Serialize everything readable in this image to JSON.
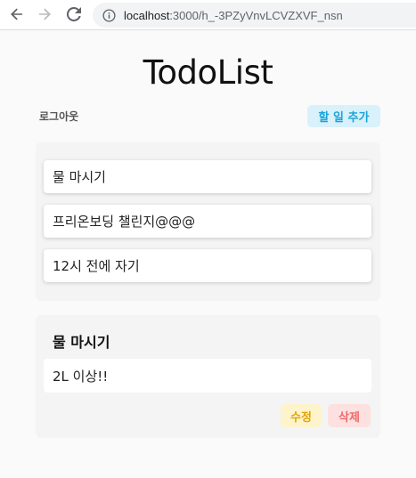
{
  "browser": {
    "url_host": "localhost",
    "url_path": ":3000/h_-3PZyVnvLCVZXVF_nsn",
    "icons": {
      "back": "arrow-left-icon",
      "forward": "arrow-right-icon",
      "reload": "reload-icon",
      "info": "info-icon"
    }
  },
  "app": {
    "title": "TodoList",
    "logout_label": "로그아웃",
    "add_label": "할 일 추가"
  },
  "todos": [
    {
      "title": "물 마시기"
    },
    {
      "title": "프리온보딩 챌린지@@@"
    },
    {
      "title": "12시 전에 자기"
    }
  ],
  "detail": {
    "title": "물 마시기",
    "content": "2L 이상!!",
    "edit_label": "수정",
    "delete_label": "삭제"
  },
  "colors": {
    "add_bg": "#d8f1fb",
    "add_text": "#1aa3d9",
    "edit_bg": "#fdf4cc",
    "edit_text": "#e3a400",
    "delete_bg": "#fde0e0",
    "delete_text": "#ee6b6b"
  }
}
